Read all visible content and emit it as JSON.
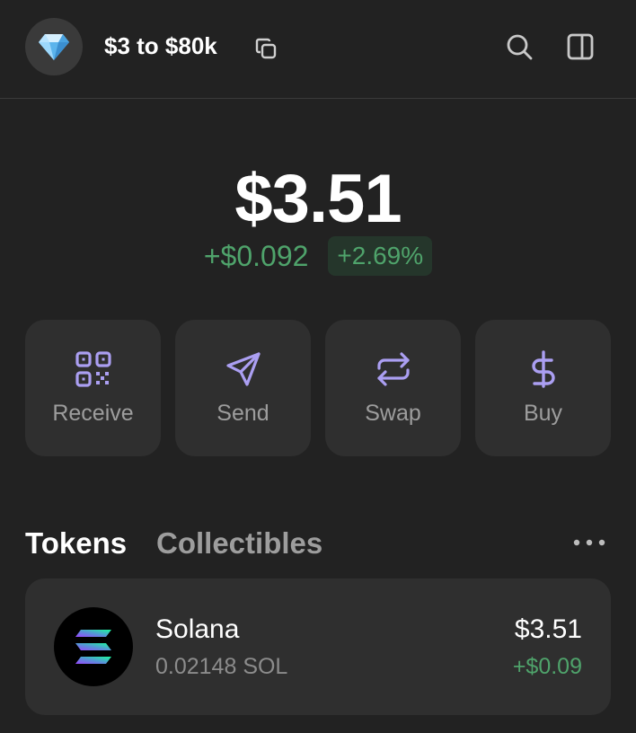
{
  "header": {
    "wallet_name": "$3 to $80k",
    "avatar_emoji": "💎"
  },
  "balance": {
    "total": "$3.51",
    "change_abs": "+$0.092",
    "change_pct": "+2.69%"
  },
  "actions": [
    {
      "label": "Receive",
      "icon": "qr-code-icon"
    },
    {
      "label": "Send",
      "icon": "send-icon"
    },
    {
      "label": "Swap",
      "icon": "swap-icon"
    },
    {
      "label": "Buy",
      "icon": "dollar-icon"
    }
  ],
  "tabs": [
    {
      "label": "Tokens",
      "active": true
    },
    {
      "label": "Collectibles",
      "active": false
    }
  ],
  "tokens": [
    {
      "name": "Solana",
      "amount": "0.02148 SOL",
      "value": "$3.51",
      "change": "+$0.09"
    }
  ],
  "colors": {
    "background": "#222222",
    "card": "#2f2f2f",
    "accent": "#ab9ff2",
    "positive": "#4fa36b",
    "muted": "#9d9d9d"
  }
}
